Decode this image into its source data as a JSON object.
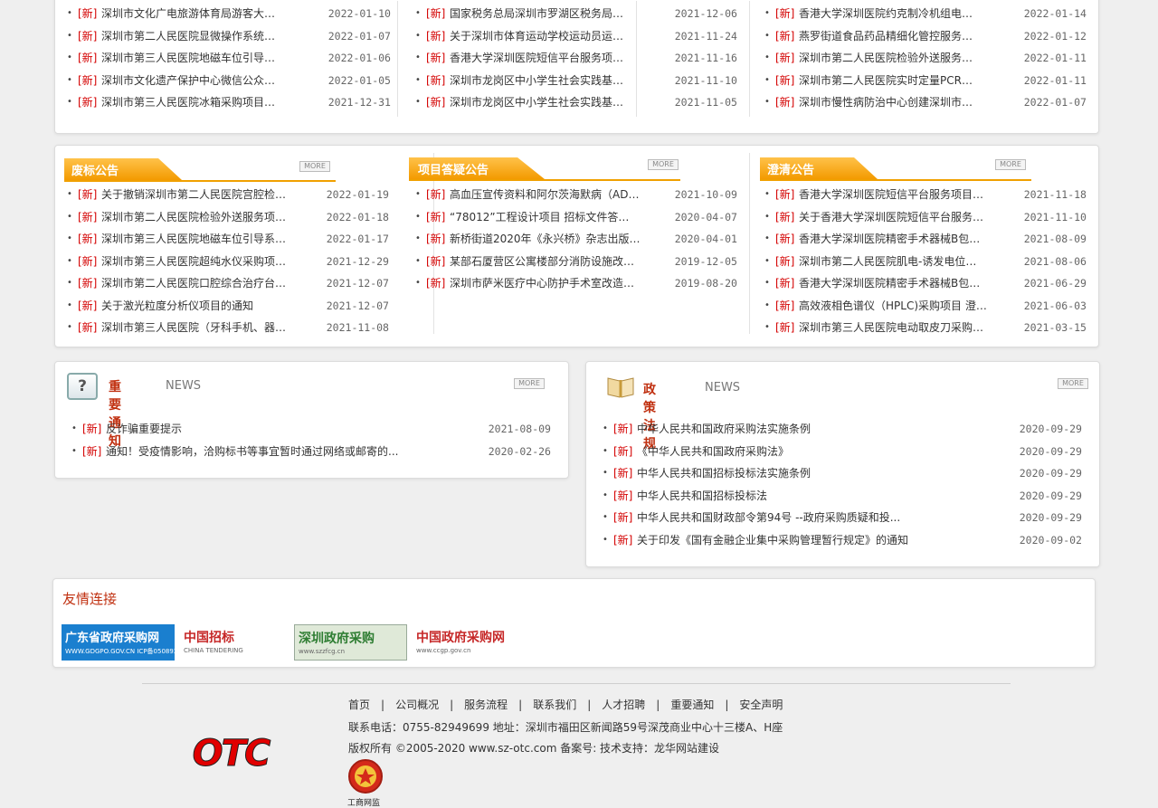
{
  "news_tag": "[新]",
  "bullet": "•",
  "top_panel": {
    "col1": [
      {
        "title": "深圳市文化广电旅游体育局游客大…",
        "date": "2022-01-10"
      },
      {
        "title": "深圳市第二人民医院显微操作系统…",
        "date": "2022-01-07"
      },
      {
        "title": "深圳市第三人民医院地磁车位引导…",
        "date": "2022-01-06"
      },
      {
        "title": "深圳市文化遗产保护中心微信公众…",
        "date": "2022-01-05"
      },
      {
        "title": "深圳市第三人民医院冰箱采购项目…",
        "date": "2021-12-31"
      }
    ],
    "col2": [
      {
        "title": "国家税务总局深圳市罗湖区税务局…",
        "date": "2021-12-06"
      },
      {
        "title": "关于深圳市体育运动学校运动员运…",
        "date": "2021-11-24"
      },
      {
        "title": "香港大学深圳医院短信平台服务项…",
        "date": "2021-11-16"
      },
      {
        "title": "深圳市龙岗区中小学生社会实践基…",
        "date": "2021-11-10"
      },
      {
        "title": "深圳市龙岗区中小学生社会实践基…",
        "date": "2021-11-05"
      }
    ],
    "col3": [
      {
        "title": "香港大学深圳医院约克制冷机组电…",
        "date": "2022-01-14"
      },
      {
        "title": "燕罗街道食品药品精细化管控服务…",
        "date": "2022-01-12"
      },
      {
        "title": "深圳市第二人民医院检验外送服务…",
        "date": "2022-01-11"
      },
      {
        "title": "深圳市第二人民医院实时定量PCR…",
        "date": "2022-01-11"
      },
      {
        "title": "深圳市慢性病防治中心创建深圳市…",
        "date": "2022-01-07"
      }
    ]
  },
  "mid_panel": {
    "more_label": "MORE",
    "col1": {
      "heading": "废标公告",
      "items": [
        {
          "title": "关于撤销深圳市第二人民医院宫腔检…",
          "date": "2022-01-19"
        },
        {
          "title": "深圳市第二人民医院检验外送服务项…",
          "date": "2022-01-18"
        },
        {
          "title": "深圳市第三人民医院地磁车位引导系…",
          "date": "2022-01-17"
        },
        {
          "title": "深圳市第三人民医院超纯水仪采购项…",
          "date": "2021-12-29"
        },
        {
          "title": "深圳市第二人民医院口腔综合治疗台…",
          "date": "2021-12-07"
        },
        {
          "title": "关于激光粒度分析仪项目的通知",
          "date": "2021-12-07"
        },
        {
          "title": "深圳市第三人民医院（牙科手机、器…",
          "date": "2021-11-08"
        }
      ]
    },
    "col2": {
      "heading": "项目答疑公告",
      "items": [
        {
          "title": "高血压宣传资料和阿尔茨海默病（AD…",
          "date": "2021-10-09"
        },
        {
          "title": "“78012”工程设计项目 招标文件答…",
          "date": "2020-04-07"
        },
        {
          "title": "新桥街道2020年《永兴桥》杂志出版…",
          "date": "2020-04-01"
        },
        {
          "title": "某部石厦营区公寓楼部分消防设施改…",
          "date": "2019-12-05"
        },
        {
          "title": "深圳市萨米医疗中心防护手术室改造…",
          "date": "2019-08-20"
        }
      ]
    },
    "col3": {
      "heading": "澄清公告",
      "items": [
        {
          "title": "香港大学深圳医院短信平台服务项目…",
          "date": "2021-11-18"
        },
        {
          "title": "关于香港大学深圳医院短信平台服务…",
          "date": "2021-11-10"
        },
        {
          "title": "香港大学深圳医院精密手术器械B包…",
          "date": "2021-08-09"
        },
        {
          "title": "深圳市第二人民医院肌电-诱发电位…",
          "date": "2021-08-06"
        },
        {
          "title": "香港大学深圳医院精密手术器械B包…",
          "date": "2021-06-29"
        },
        {
          "title": "高效液相色谱仪（HPLC)采购项目 澄…",
          "date": "2021-06-03"
        },
        {
          "title": "深圳市第三人民医院电动取皮刀采购…",
          "date": "2021-03-15"
        }
      ]
    }
  },
  "notice": {
    "heading": "重要通知",
    "heading_en": "NEWS",
    "icon_glyph": "?",
    "more_label": "MORE",
    "items": [
      {
        "title": "反诈骗重要提示",
        "date": "2021-08-09"
      },
      {
        "title": "通知！受疫情影响，洽购标书等事宜暂时通过网络或邮寄的...",
        "date": "2020-02-26"
      }
    ]
  },
  "policy": {
    "heading": "政策法规",
    "heading_en": "NEWS",
    "more_label": "MORE",
    "items": [
      {
        "title": "中华人民共和国政府采购法实施条例",
        "date": "2020-09-29"
      },
      {
        "title": "《中华人民共和国政府采购法》",
        "date": "2020-09-29"
      },
      {
        "title": "中华人民共和国招标投标法实施条例",
        "date": "2020-09-29"
      },
      {
        "title": "中华人民共和国招标投标法",
        "date": "2020-09-29"
      },
      {
        "title": "中华人民共和国财政部令第94号 --政府采购质疑和投...",
        "date": "2020-09-29"
      },
      {
        "title": "关于印发《国有金融企业集中采购管理暂行规定》的通知",
        "date": "2020-09-02"
      }
    ]
  },
  "friends": {
    "heading": "友情连接",
    "logos": [
      {
        "title": "广东省政府采购网",
        "sub": "WWW.GDGPO.GOV.CN  ICP备05089351",
        "color": "#1a6fc0"
      },
      {
        "title": "中国招标",
        "sub": "CHINA TENDERING",
        "color": "#c62828"
      },
      {
        "title": "深圳政府采购",
        "sub": "www.szzfcg.cn",
        "color": "#2e7d32"
      },
      {
        "title": "中国政府采购网",
        "sub": "www.ccgp.gov.cn",
        "color": "#c62828"
      }
    ]
  },
  "footer": {
    "links": [
      "首页",
      "公司概况",
      "服务流程",
      "联系我们",
      "人才招聘",
      "重要通知",
      "安全声明"
    ],
    "separator": "|",
    "contact": "联系电话：0755-82949699    地址：深圳市福田区新闻路59号深茂商业中心十三楼A、H座",
    "copyright": "版权所有 ©2005-2020 www.sz-otc.com  备案号: 技术支持：龙华网站建设",
    "logo_text": "OTC",
    "badge_text": "工商网监"
  },
  "colors": {
    "tag_red": "#d40000",
    "tab_orange": "#f39a00",
    "heading_red": "#c03010"
  }
}
